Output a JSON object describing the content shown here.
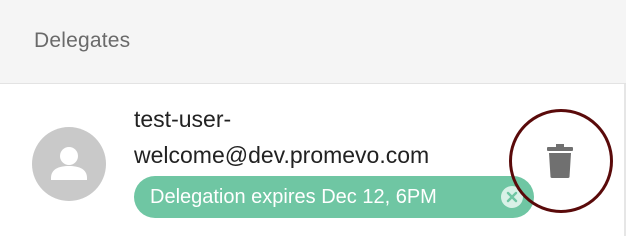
{
  "section": {
    "title": "Delegates"
  },
  "delegate": {
    "email_line1": "test-user-",
    "email_line2": "welcome@dev.promevo.com",
    "chip_label": "Delegation expires Dec 12, 6PM",
    "avatar_icon": "person-icon",
    "remove_chip_icon": "close-icon",
    "delete_icon": "trash-icon"
  },
  "colors": {
    "chip_background": "#6fc6a3",
    "avatar_background": "#c9c9c9",
    "delete_icon": "#707070",
    "highlight_ring": "#5a0a0a"
  }
}
